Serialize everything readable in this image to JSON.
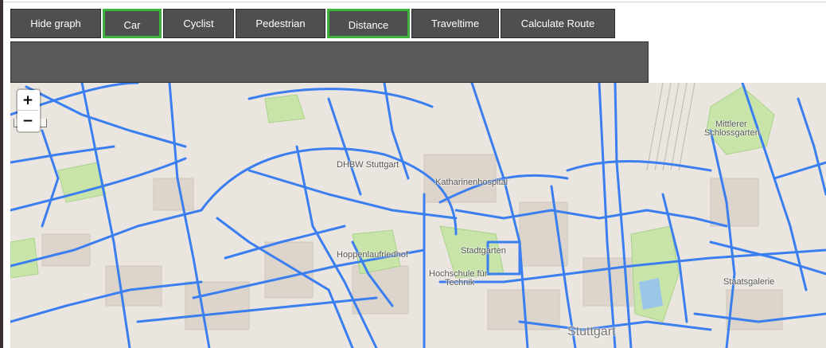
{
  "toolbar": {
    "hide_graph": "Hide graph",
    "car": "Car",
    "cyclist": "Cyclist",
    "pedestrian": "Pedestrian",
    "distance": "Distance",
    "traveltime": "Traveltime",
    "calculate_route": "Calculate Route"
  },
  "active_buttons": [
    "Car",
    "Distance"
  ],
  "zoom": {
    "in": "+",
    "out": "−"
  },
  "map_labels": {
    "dhbw": "DHBW Stuttgart",
    "hospital": "Katharinenhospital",
    "hoppenlau": "Hoppenlaufriedhof",
    "hochschule_1": "Hochschule für",
    "hochschule_2": "Technik",
    "stadtgarten": "Stadtgarten",
    "mittlerer_1": "Mittlerer",
    "mittlerer_2": "Schlossgarten",
    "galerie": "Staatsgalerie",
    "stuttgart": "Stuttgart"
  },
  "colors": {
    "road_overlay": "#3a7ef0",
    "park": "#c8e4a8",
    "active_border": "#3cb43c",
    "button": "#4f4f4f"
  }
}
